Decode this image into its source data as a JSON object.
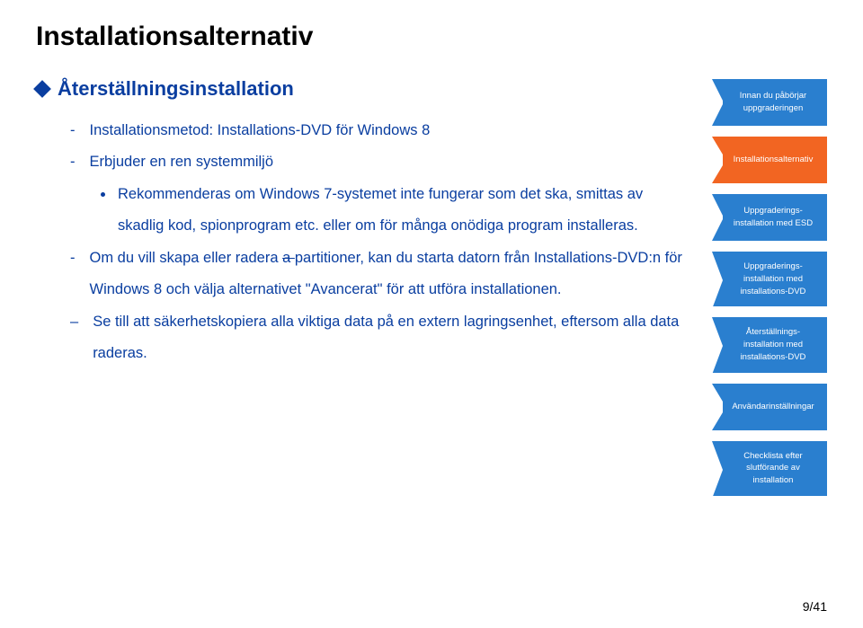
{
  "title": "Installationsalternativ",
  "subheading": "Återställningsinstallation",
  "bullets": {
    "b1": "Installationsmetod: Installations-DVD för Windows 8",
    "b2": "Erbjuder en ren systemmiljö",
    "b2a": "Rekommenderas om Windows 7-systemet inte fungerar som det ska, smittas av skadlig kod, spionprogram etc. eller om för många onödiga program installeras.",
    "b3_pre": "Om du vill skapa eller radera ",
    "b3_strike": "a ",
    "b3_post": "partitioner, kan du starta datorn från Installations-DVD:n för Windows 8 och välja alternativet \"Avancerat\" för att utföra installationen.",
    "b4": "Se till att säkerhetskopiera alla viktiga data på en extern lagringsenhet, eftersom alla data raderas."
  },
  "sidebar": {
    "items": [
      {
        "label": "Innan du påbörjar uppgraderingen"
      },
      {
        "label": "Installationsalternativ"
      },
      {
        "label": "Uppgraderings-installation med ESD"
      },
      {
        "label": "Uppgraderings-installation med installations-DVD"
      },
      {
        "label": "Återställnings-installation med installations-DVD"
      },
      {
        "label": "Användarinställningar"
      },
      {
        "label": "Checklista efter slutförande av installation"
      }
    ]
  },
  "page_number": "9/41"
}
